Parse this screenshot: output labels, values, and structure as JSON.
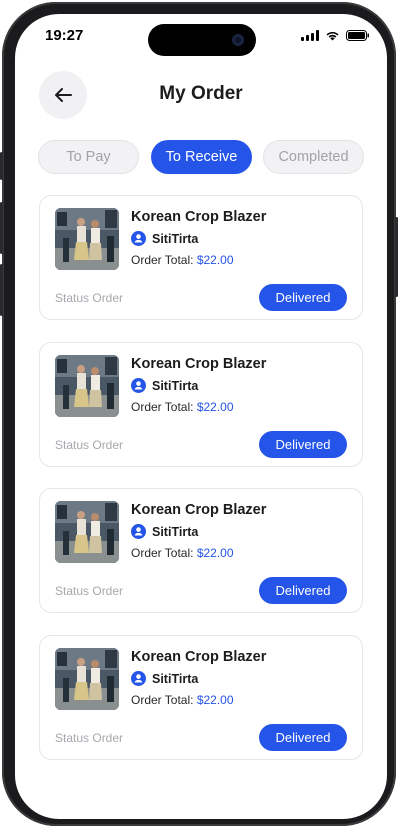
{
  "status_bar": {
    "time": "19:27",
    "icons": [
      "signal-icon",
      "wifi-icon",
      "battery-icon"
    ]
  },
  "header": {
    "title": "My Order",
    "back_icon": "arrow-left-icon"
  },
  "tabs": [
    {
      "label": "To Pay",
      "active": false
    },
    {
      "label": "To Receive",
      "active": true
    },
    {
      "label": "Completed",
      "active": false
    }
  ],
  "orders": [
    {
      "product": "Korean Crop Blazer",
      "shop": "SitiTirta",
      "total_label": "Order Total:",
      "total_value": "$22.00",
      "status_label": "Status Order",
      "status_button": "Delivered"
    },
    {
      "product": "Korean Crop Blazer",
      "shop": "SitiTirta",
      "total_label": "Order Total:",
      "total_value": "$22.00",
      "status_label": "Status Order",
      "status_button": "Delivered"
    },
    {
      "product": "Korean Crop Blazer",
      "shop": "SitiTirta",
      "total_label": "Order Total:",
      "total_value": "$22.00",
      "status_label": "Status Order",
      "status_button": "Delivered"
    },
    {
      "product": "Korean Crop Blazer",
      "shop": "SitiTirta",
      "total_label": "Order Total:",
      "total_value": "$22.00",
      "status_label": "Status Order",
      "status_button": "Delivered"
    }
  ],
  "colors": {
    "accent": "#2454e8",
    "muted": "#a3a3a8",
    "tab_bg": "#f2f2f4"
  }
}
